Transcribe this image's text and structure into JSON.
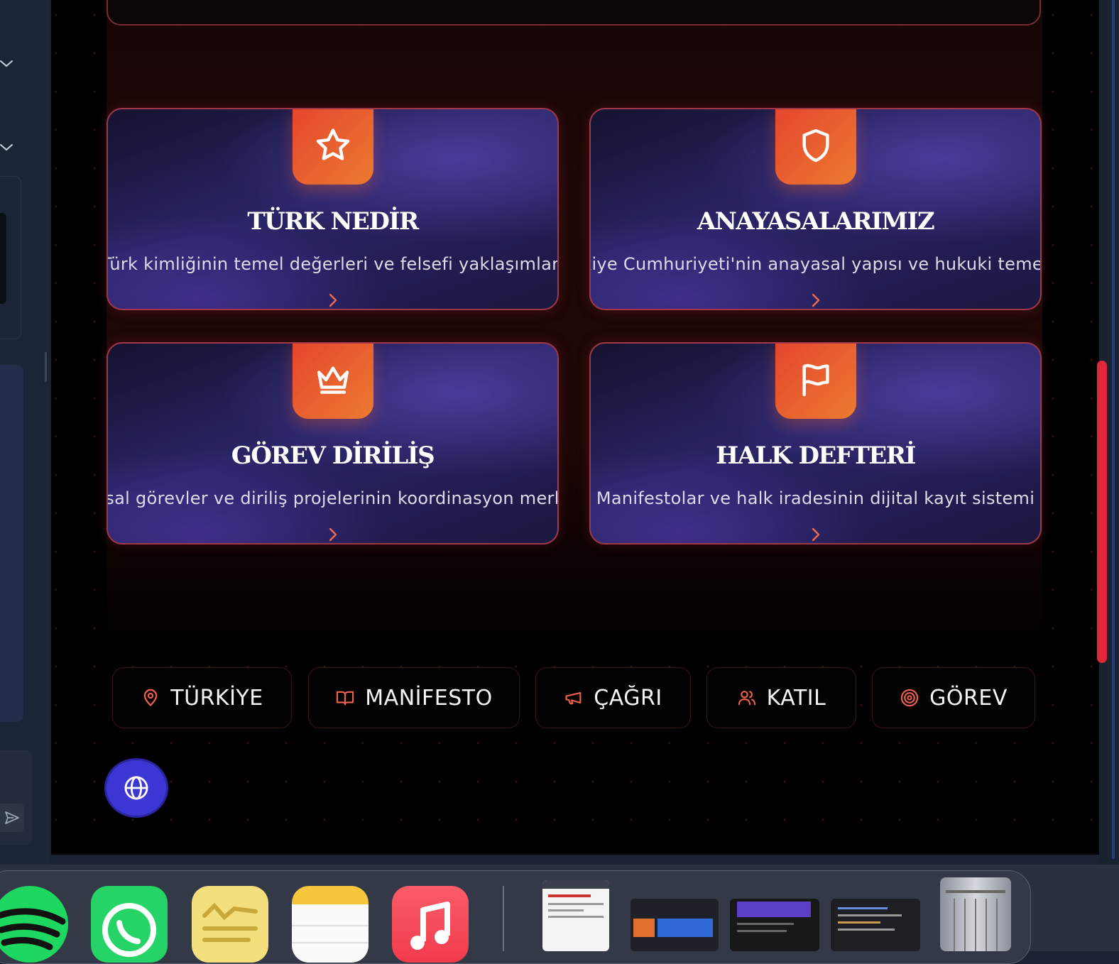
{
  "cards": [
    {
      "title": "TÜRK NEDİR",
      "description": "Türk kimliğinin temel değerleri ve felsefi yaklaşımları",
      "icon": "star-icon"
    },
    {
      "title": "ANAYASALARIMIZ",
      "description": "Türkiye Cumhuriyeti'nin anayasal yapısı ve hukuki temelleri",
      "icon": "shield-icon"
    },
    {
      "title": "GÖREV DİRİLİŞ",
      "description": "Ulusal görevler ve diriliş projelerinin koordinasyon merkezi",
      "icon": "crown-icon"
    },
    {
      "title": "HALK DEFTERİ",
      "description": "Manifestolar ve halk iradesinin dijital kayıt sistemi",
      "icon": "flag-icon"
    }
  ],
  "nav": [
    {
      "label": "TÜRKİYE",
      "icon": "map-pin-icon"
    },
    {
      "label": "MANİFESTO",
      "icon": "book-open-icon"
    },
    {
      "label": "ÇAĞRI",
      "icon": "megaphone-icon"
    },
    {
      "label": "KATIL",
      "icon": "users-icon"
    },
    {
      "label": "GÖREV",
      "icon": "target-icon"
    }
  ],
  "language_button": {
    "icon": "globe-icon"
  },
  "colors": {
    "accent": "#e5452e",
    "accent_end": "#ec7a30",
    "card_border": "#a0384a",
    "card_bg": "#2a2566",
    "page_bg": "#000000",
    "globe_button": "#3b36d4",
    "scroll_thumb": "#e0283a"
  },
  "dock": {
    "apps": [
      "spotify-icon",
      "whatsapp-icon",
      "freeform-icon",
      "notes-icon",
      "music-icon"
    ],
    "windows": [
      "browser-window-thumbnail",
      "app-window-thumbnail",
      "spotify-window-thumbnail",
      "code-editor-thumbnail"
    ],
    "trash": "trash-icon"
  }
}
